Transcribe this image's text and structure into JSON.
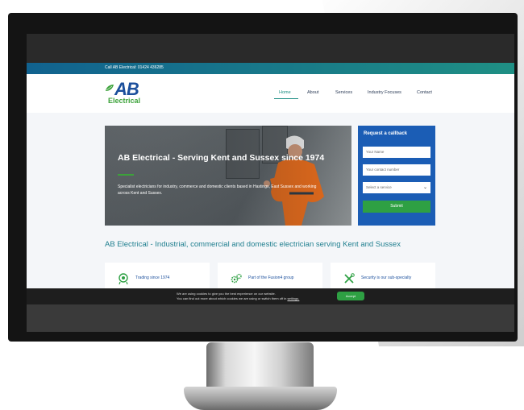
{
  "topbar": {
    "call_text": "Call AB Electrical: 01424 436285"
  },
  "logo": {
    "ab": "AB",
    "electrical": "Electrical"
  },
  "nav": {
    "items": [
      "Home",
      "About",
      "Services",
      "Industry Focuses",
      "Contact"
    ],
    "active": "Home"
  },
  "hero": {
    "title": "AB Electrical - Serving Kent and Sussex since 1974",
    "text": "Specialist electricians for industry, commerce and domestic clients based in Hastings, East Sussex and working across Kent and Sussex."
  },
  "callback": {
    "title": "Request a callback",
    "name_placeholder": "Your Name",
    "phone_placeholder": "Your contact number",
    "service_placeholder": "Select a service",
    "submit_label": "Submit"
  },
  "tagline": "AB Electrical - Industrial, commercial and domestic electrician serving Kent and Sussex",
  "features": [
    {
      "icon": "award-icon",
      "text": "Trading since 1974"
    },
    {
      "icon": "gears-icon",
      "text": "Part of the Fusion4 group"
    },
    {
      "icon": "tools-icon",
      "text": "Security is our sub-specialty"
    }
  ],
  "cookie": {
    "line1": "We are using cookies to give you the best experience on our website.",
    "line2_prefix": "You can find out more about which cookies we are using or switch them off in",
    "settings_link": "settings.",
    "accept_label": "Accept"
  },
  "colors": {
    "brand_blue": "#1b4f9c",
    "brand_green": "#3ca23a",
    "teal": "#1f8f84",
    "callback_blue": "#1b5db5"
  }
}
